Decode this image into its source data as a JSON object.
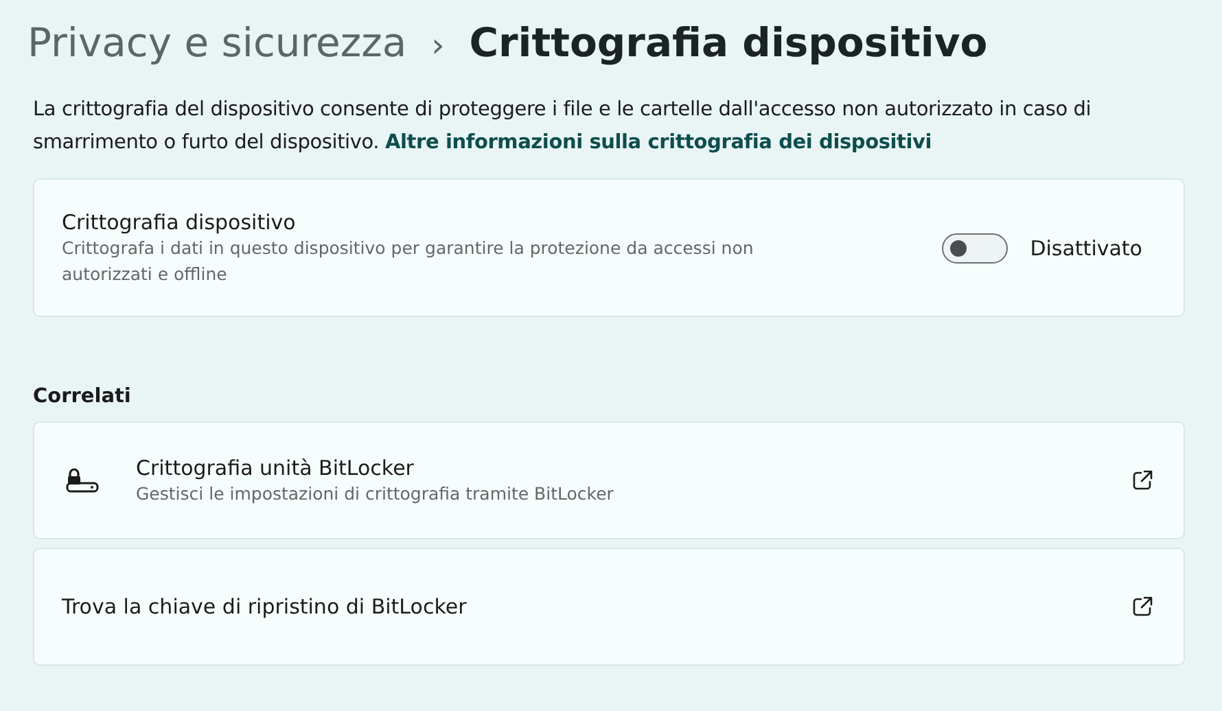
{
  "breadcrumb": {
    "parent": "Privacy e sicurezza",
    "separator": "›",
    "current": "Crittografia dispositivo"
  },
  "intro": {
    "text": "La crittografia del dispositivo consente di proteggere i file e le cartelle dall'accesso non autorizzato in caso di smarrimento o furto del dispositivo.",
    "link": "Altre informazioni sulla crittografia dei dispositivi"
  },
  "setting": {
    "title": "Crittografia dispositivo",
    "description": "Crittografa i dati in questo dispositivo per garantire la protezione da accessi non autorizzati e offline",
    "on": false,
    "state_label": "Disattivato"
  },
  "related": {
    "heading": "Correlati",
    "items": [
      {
        "kind": "drive",
        "title": "Crittografia unità BitLocker",
        "description": "Gestisci le impostazioni di crittografia tramite BitLocker"
      },
      {
        "kind": "plain",
        "title": "Trova la chiave di ripristino di BitLocker"
      }
    ]
  }
}
